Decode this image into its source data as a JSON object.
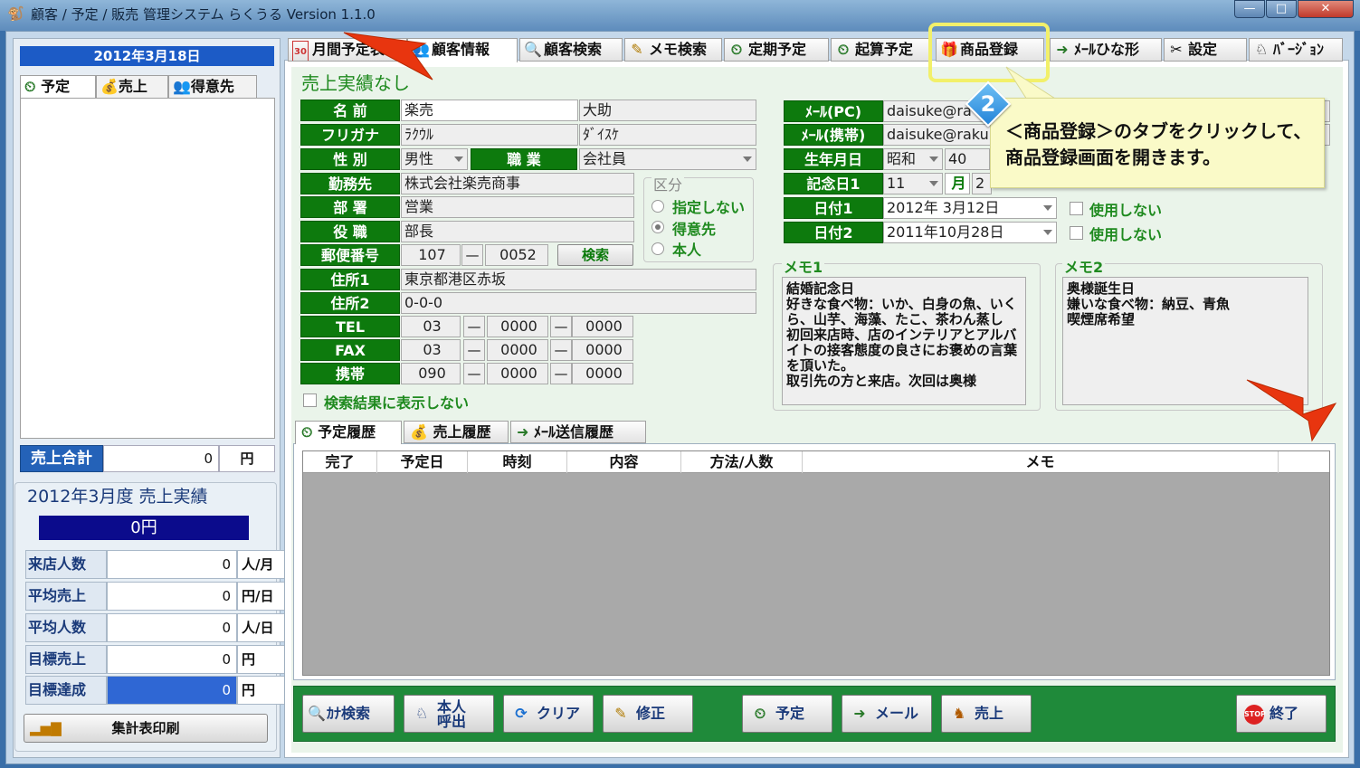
{
  "window": {
    "title": "顧客 / 予定 / 販売 管理システム らくうる  Version 1.1.0",
    "min": "—",
    "max": "□",
    "close": "✕"
  },
  "left": {
    "date": "2012年3月18日",
    "tabs": [
      "予定",
      "売上",
      "得意先"
    ],
    "sales_total": {
      "label": "売上合計",
      "value": "0",
      "unit": "円"
    },
    "month": {
      "title": "2012年3月度  売上実績",
      "value": "0円",
      "rows": [
        {
          "label": "来店人数",
          "value": "0",
          "unit": "人/月"
        },
        {
          "label": "平均売上",
          "value": "0",
          "unit": "円/日"
        },
        {
          "label": "平均人数",
          "value": "0",
          "unit": "人/日"
        },
        {
          "label": "目標売上",
          "value": "0",
          "unit": "円"
        },
        {
          "label": "目標達成",
          "value": "0",
          "unit": "円"
        }
      ]
    },
    "print_button": "集計表印刷"
  },
  "tabs": [
    {
      "label": "月間予定表",
      "icon": "30"
    },
    {
      "label": "顧客情報",
      "icon": "👥"
    },
    {
      "label": "顧客検索",
      "icon": "🔍"
    },
    {
      "label": "メモ検索",
      "icon": "✎"
    },
    {
      "label": "定期予定",
      "icon": "⏲"
    },
    {
      "label": "起算予定",
      "icon": "⏲"
    },
    {
      "label": "商品登録",
      "icon": "🎁"
    },
    {
      "label": "ﾒｰﾙひな形",
      "icon": "➜"
    },
    {
      "label": "設定",
      "icon": "✂"
    },
    {
      "label": "ﾊﾞｰｼﾞｮﾝ",
      "icon": "♘"
    }
  ],
  "form": {
    "no_sales": "売上実績なし",
    "name_label": "名  前",
    "last_name": "楽売",
    "first_name": "大助",
    "kana_label": "フリガナ",
    "last_kana": "ﾗｸｳﾙ",
    "first_kana": "ﾀﾞｲｽｹ",
    "gender_label": "性  別",
    "gender": "男性",
    "job_label": "職  業",
    "job": "会社員",
    "company_label": "勤務先",
    "company": "株式会社楽売商事",
    "dept_label": "部  署",
    "dept": "営業",
    "position_label": "役  職",
    "position": "部長",
    "zip_label": "郵便番号",
    "zip1": "107",
    "zip2": "0052",
    "zip_search": "検索",
    "addr1_label": "住所1",
    "addr1": "東京都港区赤坂",
    "addr2_label": "住所2",
    "addr2": "0-0-0",
    "tel_label": "TEL",
    "tel": [
      "03",
      "0000",
      "0000"
    ],
    "fax_label": "FAX",
    "fax": [
      "03",
      "0000",
      "0000"
    ],
    "mobile_label": "携帯",
    "mobile": [
      "090",
      "0000",
      "0000"
    ],
    "dash": "—",
    "hide_in_search": "検索結果に表示しない",
    "kubun": {
      "title": "区分",
      "options": [
        "指定しない",
        "得意先",
        "本人"
      ],
      "selected": 1
    },
    "mail_pc_label": "ﾒｰﾙ(PC)",
    "mail_pc": "daisuke@ra",
    "mail_mobile_label": "ﾒｰﾙ(携帯)",
    "mail_mobile": "daisuke@raku",
    "birthday_label": "生年月日",
    "era": "昭和",
    "era_year": "40",
    "anniv1_label": "記念日1",
    "anniv1_day": "11",
    "anniv1_month": "月",
    "anniv_extra": "2",
    "date1_label": "日付1",
    "date1": "2012年  3月12日",
    "date1_unused": "使用しない",
    "date2_label": "日付2",
    "date2": "2011年10月28日",
    "date2_unused": "使用しない",
    "memo1_label": "メモ1",
    "memo1": "結婚記念日\n好きな食べ物：いか、白身の魚、いくら、山芋、海藻、たこ、茶わん蒸し\n初回来店時、店のインテリアとアルバイトの接客態度の良さにお褒めの言葉を頂いた。\n取引先の方と来店。次回は奥様",
    "memo2_label": "メモ2",
    "memo2": "奥様誕生日\n嫌いな食べ物：納豆、青魚\n喫煙席希望"
  },
  "history": {
    "tabs": [
      "予定履歴",
      "売上履歴",
      "ﾒｰﾙ送信履歴"
    ],
    "columns": [
      "完了",
      "予定日",
      "時刻",
      "内容",
      "方法/人数",
      "メモ"
    ]
  },
  "buttons": [
    {
      "label": "ｶﾅ検索",
      "icon": "🔍"
    },
    {
      "label": "本人\n呼出",
      "icon": "♘"
    },
    {
      "label": "クリア",
      "icon": "⟳"
    },
    {
      "label": "修正",
      "icon": "✎"
    },
    {
      "label": "予定",
      "icon": "⏲"
    },
    {
      "label": "メール",
      "icon": "➜"
    },
    {
      "label": "売上",
      "icon": "♞"
    },
    {
      "label": "終了",
      "icon": "STOP"
    }
  ],
  "annotation": {
    "badge": "2",
    "callout": "＜商品登録＞のタブをクリックして、\n商品登録画面を開きます。"
  },
  "colors": {
    "accent_green": "#0d7a0d",
    "accent_blue": "#2462b8",
    "callout_bg": "#fafac8",
    "highlight": "#f2f06a",
    "arrow": "#e8350f"
  }
}
